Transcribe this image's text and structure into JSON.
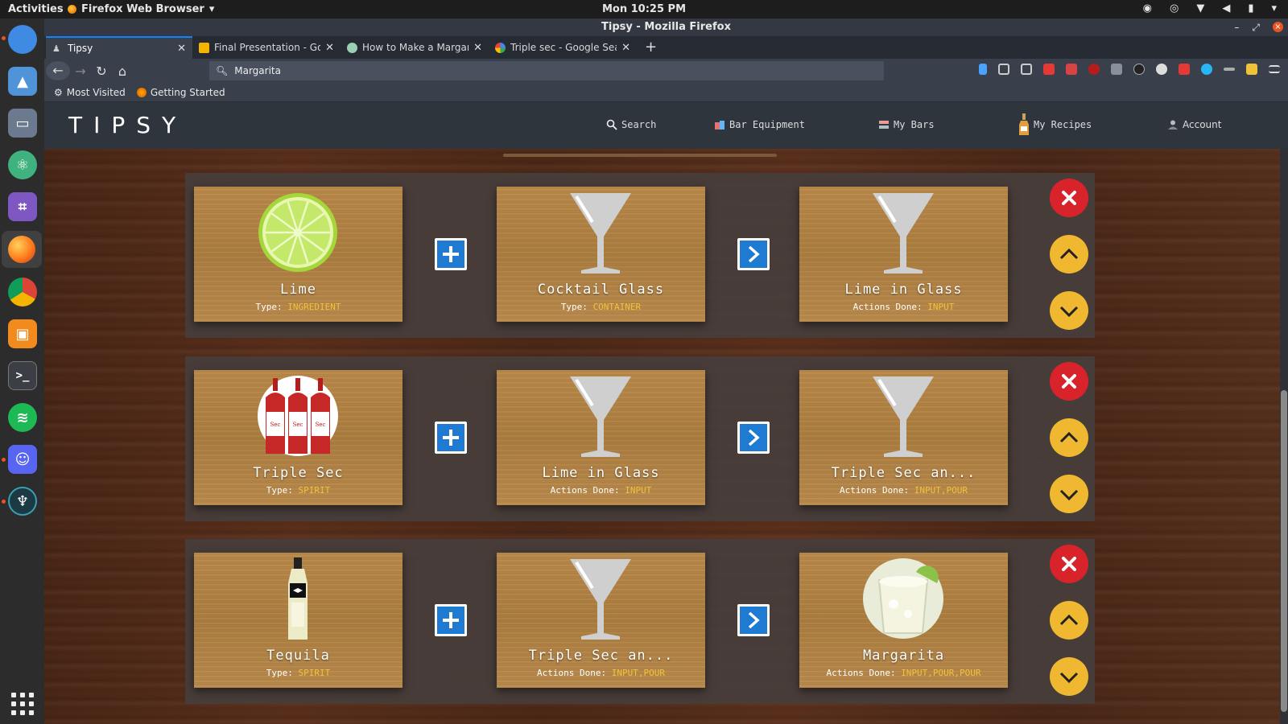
{
  "system": {
    "activities_label": "Activities",
    "app_menu_label": "Firefox Web Browser",
    "clock": "Mon 10:25 PM"
  },
  "window": {
    "title": "Tipsy - Mozilla Firefox"
  },
  "tabs": [
    {
      "title": "Tipsy",
      "selected": true
    },
    {
      "title": "Final Presentation - Goo",
      "selected": false
    },
    {
      "title": "How to Make a Margarit",
      "selected": false
    },
    {
      "title": "Triple sec - Google Searc",
      "selected": false
    }
  ],
  "urlbar": {
    "value": "Margarita"
  },
  "bookmarks": [
    {
      "label": "Most Visited"
    },
    {
      "label": "Getting Started"
    }
  ],
  "app": {
    "logo": "TIPSY",
    "nav": [
      {
        "label": "Search",
        "icon": "search-icon"
      },
      {
        "label": "Bar Equipment",
        "icon": "bar-equipment-icon"
      },
      {
        "label": "My Bars",
        "icon": "my-bars-icon"
      },
      {
        "label": "My Recipes",
        "icon": "bottle-icon"
      },
      {
        "label": "Account",
        "icon": "account-icon"
      }
    ]
  },
  "steps": [
    {
      "input": {
        "name": "Lime",
        "meta_label": "Type:",
        "meta_value": "INGREDIENT",
        "art": "lime"
      },
      "operator": "plus",
      "container": {
        "name": "Cocktail Glass",
        "meta_label": "Type:",
        "meta_value": "CONTAINER",
        "art": "glass"
      },
      "result": {
        "name": "Lime in Glass",
        "meta_label": "Actions Done:",
        "meta_value": "INPUT",
        "art": "glass"
      }
    },
    {
      "input": {
        "name": "Triple Sec",
        "meta_label": "Type:",
        "meta_value": "SPIRIT",
        "art": "triplesec"
      },
      "operator": "plus",
      "container": {
        "name": "Lime in Glass",
        "meta_label": "Actions Done:",
        "meta_value": "INPUT",
        "art": "glass"
      },
      "result": {
        "name": "Triple Sec an...",
        "meta_label": "Actions Done:",
        "meta_value": "INPUT,POUR",
        "art": "glass"
      }
    },
    {
      "input": {
        "name": "Tequila",
        "meta_label": "Type:",
        "meta_value": "SPIRIT",
        "art": "tequila"
      },
      "operator": "plus",
      "container": {
        "name": "Triple Sec an...",
        "meta_label": "Actions Done:",
        "meta_value": "INPUT,POUR",
        "art": "glass"
      },
      "result": {
        "name": "Margarita",
        "meta_label": "Actions Done:",
        "meta_value": "INPUT,POUR,POUR",
        "art": "margarita"
      }
    }
  ],
  "colors": {
    "delete": "#d9232b",
    "move": "#f0b830",
    "operator": "#1f7ad1",
    "meta_value": "#f0c23a"
  }
}
